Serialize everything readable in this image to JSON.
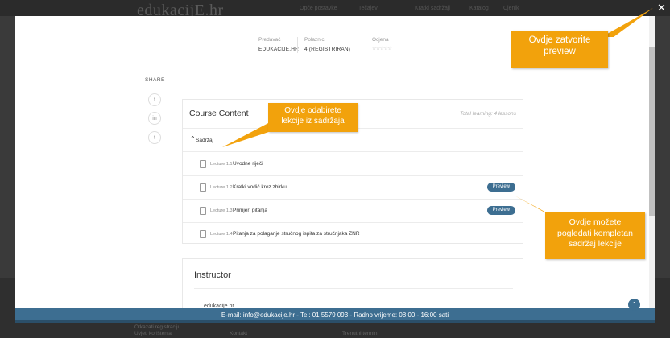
{
  "background": {
    "logo": "edukacijE.hr",
    "nav": [
      "Opće postavke",
      "Tečajevi",
      "Kratki sadržaji",
      "Katalog",
      "Cjenik"
    ],
    "footer_texts": [
      "Otkazati registraciju",
      "Uvjeti korištenja",
      "Kontakt",
      "Trenutni termin"
    ]
  },
  "modal": {
    "close_icon": "close-icon",
    "meta": {
      "instructor_label": "Predavač",
      "instructor_value": "EDUKACIJE.HR",
      "students_label": "Polaznici",
      "students_value": "4 (REGISTRIRAN)",
      "rating_label": "Ocjena",
      "rating_stars": "☆☆☆☆☆"
    },
    "share": {
      "label": "SHARE",
      "buttons": [
        "f",
        "in",
        "t"
      ]
    },
    "course_content": {
      "title": "Course Content",
      "total": "Total learning: 4 lessons",
      "section": "Sadržaj",
      "lectures": [
        {
          "num": "Lecture 1.1",
          "title": "Uvodne riječi",
          "preview": ""
        },
        {
          "num": "Lecture 1.2",
          "title": "Kratki vodič kroz zbirku",
          "preview": "Preview"
        },
        {
          "num": "Lecture 1.3",
          "title": "Primjeri pitanja",
          "preview": "Preview"
        },
        {
          "num": "Lecture 1.4",
          "title": "Pitanja za polaganje stručnog ispita za stručnjaka ZNR",
          "preview": ""
        }
      ]
    },
    "instructor": {
      "title": "Instructor",
      "name": "edukacije.hr"
    }
  },
  "bottom_bar": "E-mail: info@edukacije.hr - Tel: 01 5579 093 - Radno vrijeme: 08:00 - 16:00 sati",
  "callouts": {
    "close": {
      "line1": "Ovdje zatvorite",
      "line2": "preview"
    },
    "content": {
      "line1": "Ovdje odabirete",
      "line2": "lekcije iz sadržaja"
    },
    "preview": {
      "line1": "Ovdje možete",
      "line2": "pogledati  kompletan",
      "line3": "sadržaj lekcije"
    }
  },
  "colors": {
    "accent": "#3d6e91",
    "callout": "#f2a20c"
  }
}
